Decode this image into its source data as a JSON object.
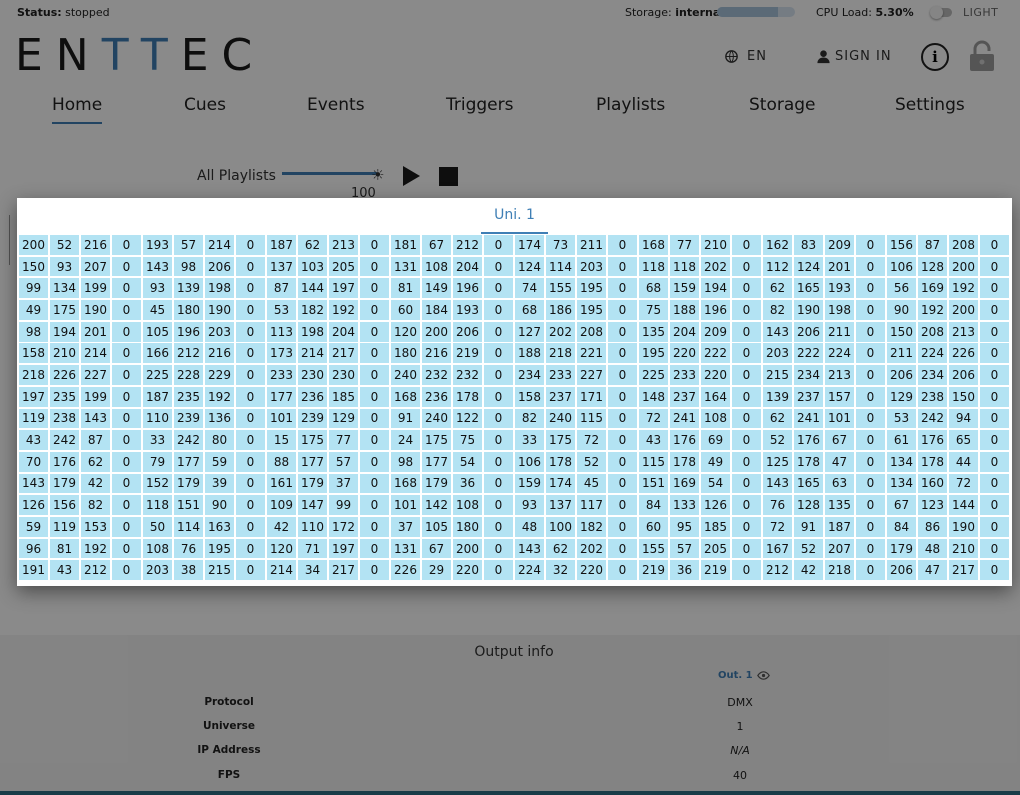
{
  "status": {
    "label": "Status:",
    "value": "stopped"
  },
  "storage": {
    "label": "Storage:",
    "value": "internal",
    "used_fraction": 0.78
  },
  "cpu": {
    "label": "CPU Load:",
    "value": "5.30%"
  },
  "theme": {
    "label": "LIGHT",
    "enabled": false
  },
  "logo": {
    "p1": "EN",
    "p2": "TT",
    "p3": "EC"
  },
  "header": {
    "language": "EN",
    "sign_in": "SIGN IN",
    "globe_icon": "globe-icon",
    "user_icon": "user-icon",
    "info_icon": "info-icon",
    "lock_icon": "lock-icon"
  },
  "nav": {
    "items": [
      "Home",
      "Cues",
      "Events",
      "Triggers",
      "Playlists",
      "Storage",
      "Settings"
    ],
    "active": "Home"
  },
  "playlists": {
    "label": "All Playlists",
    "brightness": "100",
    "brightness_level": 100,
    "play_icon": "play-icon",
    "stop_icon": "stop-icon"
  },
  "dialog": {
    "tab": "Uni. 1",
    "rows": [
      [
        200,
        52,
        216,
        0,
        193,
        57,
        214,
        0,
        187,
        62,
        213,
        0,
        181,
        67,
        212,
        0,
        174,
        73,
        211,
        0,
        168,
        77,
        210,
        0,
        162,
        83,
        209,
        0,
        156,
        87,
        208,
        0
      ],
      [
        150,
        93,
        207,
        0,
        143,
        98,
        206,
        0,
        137,
        103,
        205,
        0,
        131,
        108,
        204,
        0,
        124,
        114,
        203,
        0,
        118,
        118,
        202,
        0,
        112,
        124,
        201,
        0,
        106,
        128,
        200,
        0
      ],
      [
        99,
        134,
        199,
        0,
        93,
        139,
        198,
        0,
        87,
        144,
        197,
        0,
        81,
        149,
        196,
        0,
        74,
        155,
        195,
        0,
        68,
        159,
        194,
        0,
        62,
        165,
        193,
        0,
        56,
        169,
        192,
        0
      ],
      [
        49,
        175,
        190,
        0,
        45,
        180,
        190,
        0,
        53,
        182,
        192,
        0,
        60,
        184,
        193,
        0,
        68,
        186,
        195,
        0,
        75,
        188,
        196,
        0,
        82,
        190,
        198,
        0,
        90,
        192,
        200,
        0
      ],
      [
        98,
        194,
        201,
        0,
        105,
        196,
        203,
        0,
        113,
        198,
        204,
        0,
        120,
        200,
        206,
        0,
        127,
        202,
        208,
        0,
        135,
        204,
        209,
        0,
        143,
        206,
        211,
        0,
        150,
        208,
        213,
        0
      ],
      [
        158,
        210,
        214,
        0,
        166,
        212,
        216,
        0,
        173,
        214,
        217,
        0,
        180,
        216,
        219,
        0,
        188,
        218,
        221,
        0,
        195,
        220,
        222,
        0,
        203,
        222,
        224,
        0,
        211,
        224,
        226,
        0
      ],
      [
        218,
        226,
        227,
        0,
        225,
        228,
        229,
        0,
        233,
        230,
        230,
        0,
        240,
        232,
        232,
        0,
        234,
        233,
        227,
        0,
        225,
        233,
        220,
        0,
        215,
        234,
        213,
        0,
        206,
        234,
        206,
        0
      ],
      [
        197,
        235,
        199,
        0,
        187,
        235,
        192,
        0,
        177,
        236,
        185,
        0,
        168,
        236,
        178,
        0,
        158,
        237,
        171,
        0,
        148,
        237,
        164,
        0,
        139,
        237,
        157,
        0,
        129,
        238,
        150,
        0
      ],
      [
        119,
        238,
        143,
        0,
        110,
        239,
        136,
        0,
        101,
        239,
        129,
        0,
        91,
        240,
        122,
        0,
        82,
        240,
        115,
        0,
        72,
        241,
        108,
        0,
        62,
        241,
        101,
        0,
        53,
        242,
        94,
        0
      ],
      [
        43,
        242,
        87,
        0,
        33,
        242,
        80,
        0,
        15,
        175,
        77,
        0,
        24,
        175,
        75,
        0,
        33,
        175,
        72,
        0,
        43,
        176,
        69,
        0,
        52,
        176,
        67,
        0,
        61,
        176,
        65,
        0
      ],
      [
        70,
        176,
        62,
        0,
        79,
        177,
        59,
        0,
        88,
        177,
        57,
        0,
        98,
        177,
        54,
        0,
        106,
        178,
        52,
        0,
        115,
        178,
        49,
        0,
        125,
        178,
        47,
        0,
        134,
        178,
        44,
        0
      ],
      [
        143,
        179,
        42,
        0,
        152,
        179,
        39,
        0,
        161,
        179,
        37,
        0,
        168,
        179,
        36,
        0,
        159,
        174,
        45,
        0,
        151,
        169,
        54,
        0,
        143,
        165,
        63,
        0,
        134,
        160,
        72,
        0
      ],
      [
        126,
        156,
        82,
        0,
        118,
        151,
        90,
        0,
        109,
        147,
        99,
        0,
        101,
        142,
        108,
        0,
        93,
        137,
        117,
        0,
        84,
        133,
        126,
        0,
        76,
        128,
        135,
        0,
        67,
        123,
        144,
        0
      ],
      [
        59,
        119,
        153,
        0,
        50,
        114,
        163,
        0,
        42,
        110,
        172,
        0,
        37,
        105,
        180,
        0,
        48,
        100,
        182,
        0,
        60,
        95,
        185,
        0,
        72,
        91,
        187,
        0,
        84,
        86,
        190,
        0
      ],
      [
        96,
        81,
        192,
        0,
        108,
        76,
        195,
        0,
        120,
        71,
        197,
        0,
        131,
        67,
        200,
        0,
        143,
        62,
        202,
        0,
        155,
        57,
        205,
        0,
        167,
        52,
        207,
        0,
        179,
        48,
        210,
        0
      ],
      [
        191,
        43,
        212,
        0,
        203,
        38,
        215,
        0,
        214,
        34,
        217,
        0,
        226,
        29,
        220,
        0,
        224,
        32,
        220,
        0,
        219,
        36,
        219,
        0,
        212,
        42,
        218,
        0,
        206,
        47,
        217,
        0
      ]
    ]
  },
  "output_info": {
    "title": "Output info",
    "output_label": "Out. 1",
    "eye_icon": "eye-icon",
    "rows": [
      {
        "key": "Protocol",
        "value": "DMX"
      },
      {
        "key": "Universe",
        "value": "1"
      },
      {
        "key": "IP Address",
        "value": "N/A"
      },
      {
        "key": "FPS",
        "value": "40"
      }
    ]
  }
}
